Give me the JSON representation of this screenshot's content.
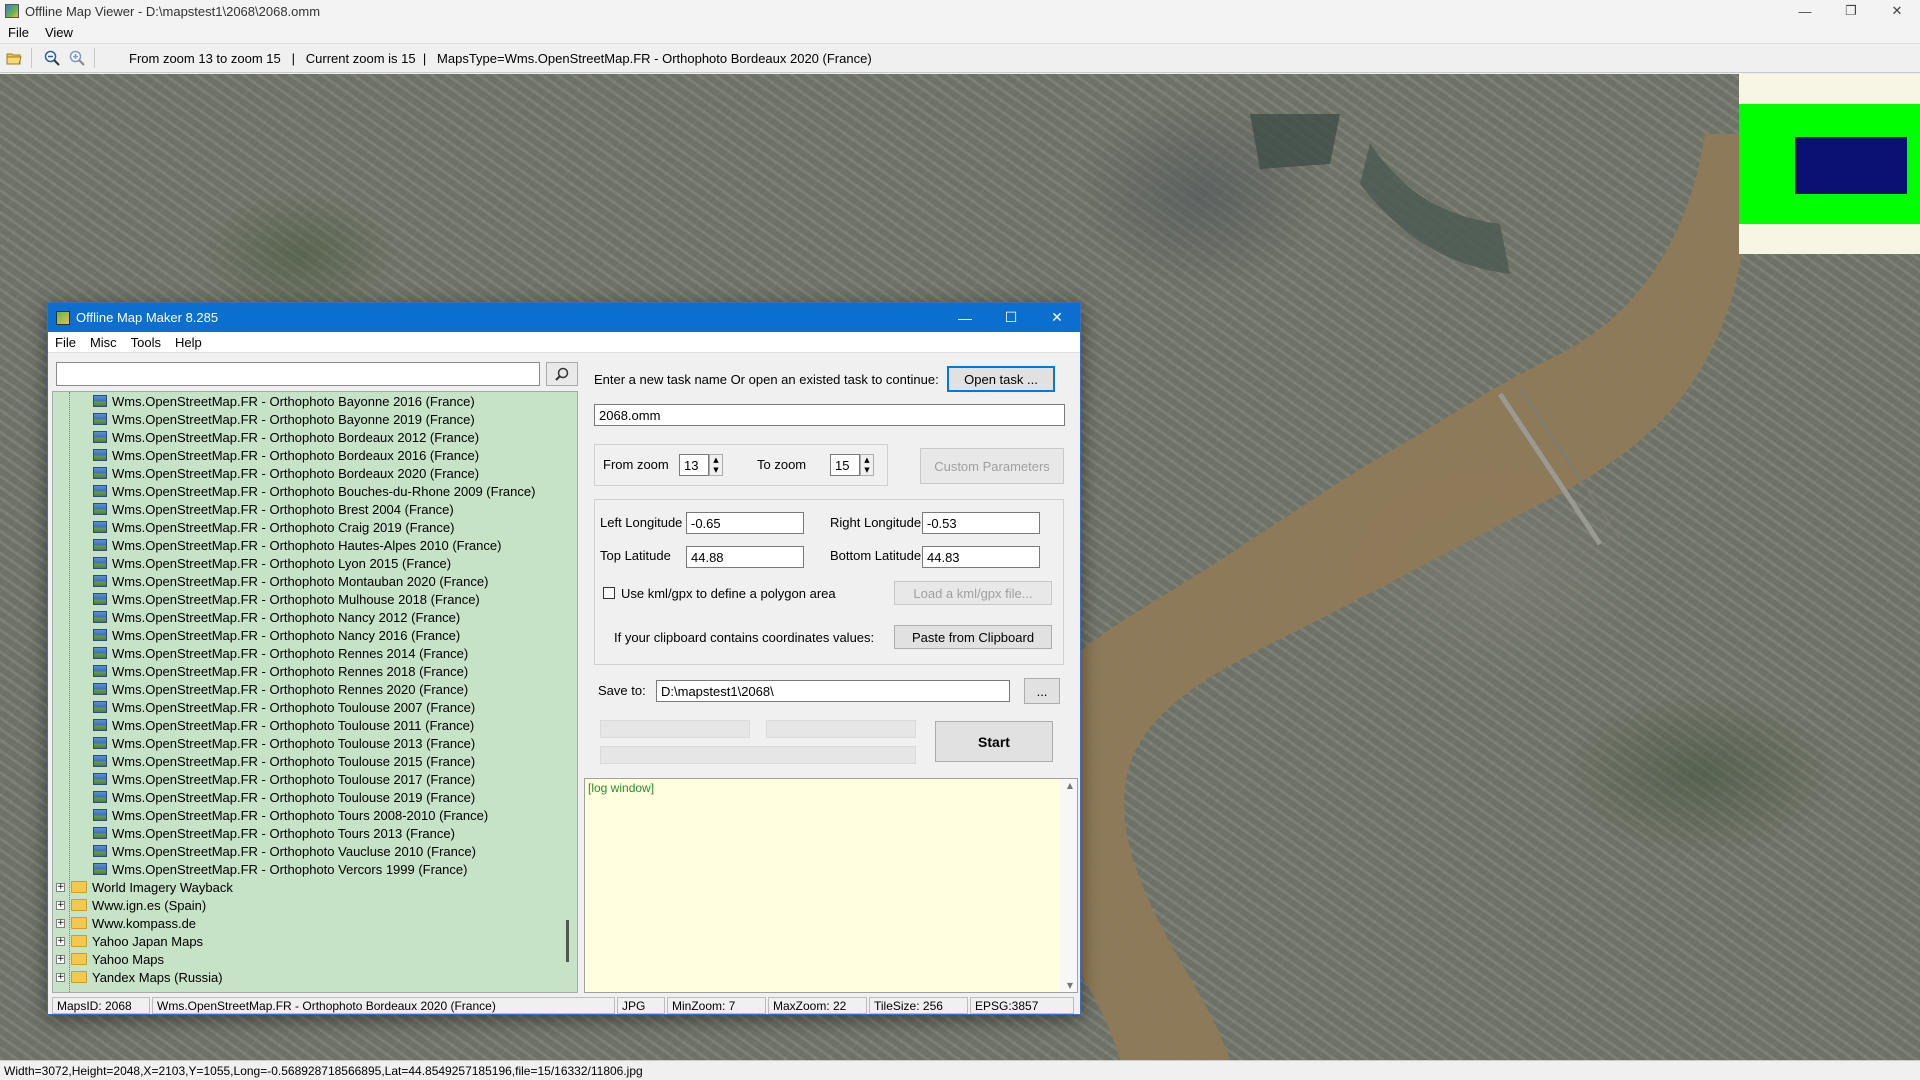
{
  "viewer": {
    "title": "Offline Map Viewer - D:\\mapstest1\\2068\\2068.omm",
    "menu": [
      "File",
      "View"
    ],
    "toolbar_info": "From zoom 13 to zoom 15   |   Current zoom is 15  |   MapsType=Wms.OpenStreetMap.FR - Orthophoto Bordeaux 2020 (France)",
    "status": "Width=3072,Height=2048,X=2103,Y=1055,Long=-0.568928718566895,Lat=44.8549257185196,file=15/16332/11806.jpg"
  },
  "dialog": {
    "title": "Offline Map Maker 8.285",
    "menu": [
      "File",
      "Misc",
      "Tools",
      "Help"
    ],
    "search": {
      "value": ""
    },
    "tree_items": [
      "Wms.OpenStreetMap.FR - Orthophoto Bayonne 2016 (France)",
      "Wms.OpenStreetMap.FR - Orthophoto Bayonne 2019 (France)",
      "Wms.OpenStreetMap.FR - Orthophoto Bordeaux 2012 (France)",
      "Wms.OpenStreetMap.FR - Orthophoto Bordeaux 2016 (France)",
      "Wms.OpenStreetMap.FR - Orthophoto Bordeaux 2020 (France)",
      "Wms.OpenStreetMap.FR - Orthophoto Bouches-du-Rhone 2009 (France)",
      "Wms.OpenStreetMap.FR - Orthophoto Brest 2004 (France)",
      "Wms.OpenStreetMap.FR - Orthophoto Craig 2019 (France)",
      "Wms.OpenStreetMap.FR - Orthophoto Hautes-Alpes 2010 (France)",
      "Wms.OpenStreetMap.FR - Orthophoto Lyon 2015 (France)",
      "Wms.OpenStreetMap.FR - Orthophoto Montauban 2020 (France)",
      "Wms.OpenStreetMap.FR - Orthophoto Mulhouse 2018 (France)",
      "Wms.OpenStreetMap.FR - Orthophoto Nancy 2012 (France)",
      "Wms.OpenStreetMap.FR - Orthophoto Nancy 2016 (France)",
      "Wms.OpenStreetMap.FR - Orthophoto Rennes 2014 (France)",
      "Wms.OpenStreetMap.FR - Orthophoto Rennes 2018 (France)",
      "Wms.OpenStreetMap.FR - Orthophoto Rennes 2020 (France)",
      "Wms.OpenStreetMap.FR - Orthophoto Toulouse 2007 (France)",
      "Wms.OpenStreetMap.FR - Orthophoto Toulouse 2011 (France)",
      "Wms.OpenStreetMap.FR - Orthophoto Toulouse 2013 (France)",
      "Wms.OpenStreetMap.FR - Orthophoto Toulouse 2015 (France)",
      "Wms.OpenStreetMap.FR - Orthophoto Toulouse 2017 (France)",
      "Wms.OpenStreetMap.FR - Orthophoto Toulouse 2019 (France)",
      "Wms.OpenStreetMap.FR - Orthophoto Tours 2008-2010 (France)",
      "Wms.OpenStreetMap.FR - Orthophoto Tours 2013 (France)",
      "Wms.OpenStreetMap.FR - Orthophoto Vaucluse 2010 (France)",
      "Wms.OpenStreetMap.FR - Orthophoto Vercors 1999 (France)"
    ],
    "tree_folders": [
      "World Imagery Wayback",
      "Www.ign.es (Spain)",
      "Www.kompass.de",
      "Yahoo Japan Maps",
      "Yahoo Maps",
      "Yandex Maps (Russia)"
    ],
    "task_prompt": "Enter a new task name Or open an existed task to continue:",
    "open_task_label": "Open task ...",
    "task_name": "2068.omm",
    "from_zoom_label": "From zoom",
    "from_zoom": "13",
    "to_zoom_label": "To zoom",
    "to_zoom": "15",
    "custom_params_label": "Custom Parameters",
    "left_lon_label": "Left Longitude",
    "left_lon": "-0.65",
    "right_lon_label": "Right Longitude",
    "right_lon": "-0.53",
    "top_lat_label": "Top Latitude",
    "top_lat": "44.88",
    "bottom_lat_label": "Bottom Latitude",
    "bottom_lat": "44.83",
    "kml_label": "Use kml/gpx to define a polygon area",
    "kml_checked": false,
    "load_kml_label": "Load a kml/gpx file...",
    "clipboard_prompt": "If your clipboard contains coordinates values:",
    "paste_label": "Paste from Clipboard",
    "save_to_label": "Save to:",
    "save_to": "D:\\mapstest1\\2068\\",
    "browse_label": "...",
    "start_label": "Start",
    "log_text": "[log window]",
    "status": {
      "maps_id": "MapsID: 2068",
      "maps_name": "Wms.OpenStreetMap.FR - Orthophoto Bordeaux 2020 (France)",
      "format": "JPG",
      "min_zoom": "MinZoom: 7",
      "max_zoom": "MaxZoom: 22",
      "tile_size": "TileSize: 256",
      "epsg": "EPSG:3857"
    }
  },
  "colors": {
    "tree_bg": "#c6e2c7",
    "dialog_title_bg": "#0b6fcf",
    "log_bg": "#ffffe0",
    "river": "#8f7a59",
    "overview_green": "#00ff00",
    "overview_navy": "#0a1172"
  }
}
